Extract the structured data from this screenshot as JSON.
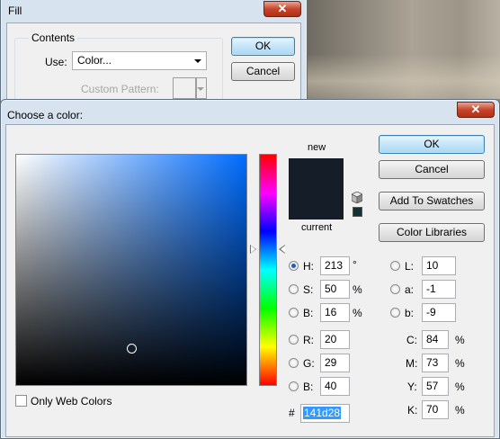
{
  "fill_dialog": {
    "title": "Fill",
    "close_glyph": "✕",
    "contents_group_label": "Contents",
    "use_label": "Use:",
    "use_value": "Color...",
    "custom_pattern_label": "Custom Pattern:",
    "ok_label": "OK",
    "cancel_label": "Cancel"
  },
  "picker": {
    "title": "Choose a color:",
    "close_glyph": "✕",
    "new_label": "new",
    "current_label": "current",
    "new_color": "#141d28",
    "current_color": "#141d28",
    "web_safe_color": "#0f3333",
    "hue_color": "#006cff",
    "buttons": {
      "ok": "OK",
      "cancel": "Cancel",
      "add_to_swatches": "Add To Swatches",
      "color_libraries": "Color Libraries"
    },
    "hsb": [
      {
        "key": "h",
        "label": "H:",
        "value": "213",
        "unit": "°",
        "selected": true
      },
      {
        "key": "s",
        "label": "S:",
        "value": "50",
        "unit": "%",
        "selected": false
      },
      {
        "key": "b",
        "label": "B:",
        "value": "16",
        "unit": "%",
        "selected": false
      }
    ],
    "rgb": [
      {
        "key": "r",
        "label": "R:",
        "value": "20",
        "selected": false
      },
      {
        "key": "g",
        "label": "G:",
        "value": "29",
        "selected": false
      },
      {
        "key": "b",
        "label": "B:",
        "value": "40",
        "selected": false
      }
    ],
    "lab": [
      {
        "key": "l",
        "label": "L:",
        "value": "10",
        "selected": false
      },
      {
        "key": "a",
        "label": "a:",
        "value": "-1",
        "selected": false
      },
      {
        "key": "b",
        "label": "b:",
        "value": "-9",
        "selected": false
      }
    ],
    "cmyk": [
      {
        "key": "c",
        "label": "C:",
        "value": "84",
        "unit": "%"
      },
      {
        "key": "m",
        "label": "M:",
        "value": "73",
        "unit": "%"
      },
      {
        "key": "y",
        "label": "Y:",
        "value": "57",
        "unit": "%"
      },
      {
        "key": "k",
        "label": "K:",
        "value": "70",
        "unit": "%"
      }
    ],
    "hex_label": "#",
    "hex_value": "141d28",
    "only_web_colors_label": "Only Web Colors",
    "only_web_colors_checked": false,
    "icons": [
      "gamut-cube-icon",
      "web-safe-swatch-icon",
      "hue-slider-triangle-icon",
      "color-field-cursor-icon"
    ]
  }
}
